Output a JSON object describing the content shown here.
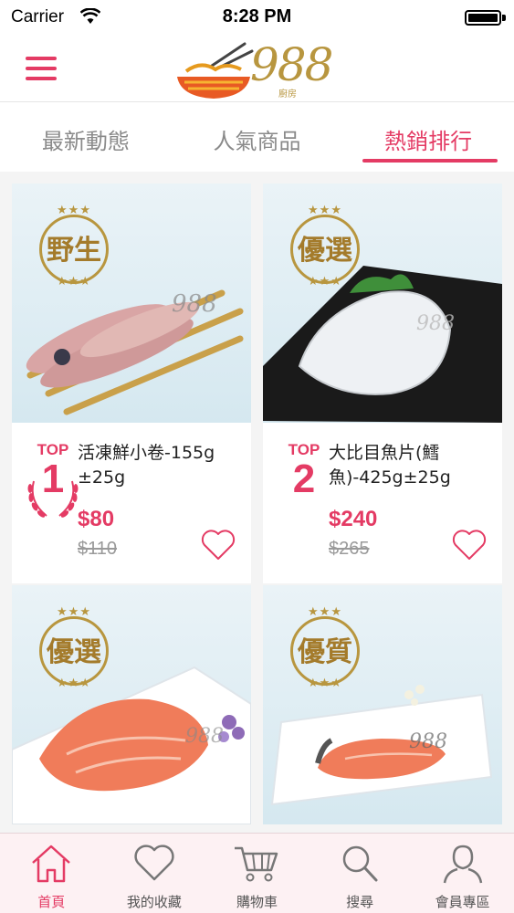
{
  "status_bar": {
    "carrier": "Carrier",
    "time": "8:28 PM"
  },
  "header": {
    "logo_text": "988",
    "logo_sub": "廚房"
  },
  "tabs": [
    {
      "label": "最新動態"
    },
    {
      "label": "人氣商品"
    },
    {
      "label": "熱銷排行"
    }
  ],
  "products": [
    {
      "badge": "野生",
      "rank_label": "TOP",
      "rank": "1",
      "name": "活凍鮮小卷-155g ±25g",
      "price": "$80",
      "old_price": "$110"
    },
    {
      "badge": "優選",
      "rank_label": "TOP",
      "rank": "2",
      "name": "大比目魚片(鱈魚)-425g±25g",
      "price": "$240",
      "old_price": "$265"
    },
    {
      "badge": "優選"
    },
    {
      "badge": "優質"
    }
  ],
  "bottom_tabs": [
    {
      "label": "首頁",
      "icon": "home-icon"
    },
    {
      "label": "我的收藏",
      "icon": "heart-icon"
    },
    {
      "label": "購物車",
      "icon": "cart-icon"
    },
    {
      "label": "搜尋",
      "icon": "search-icon"
    },
    {
      "label": "會員專區",
      "icon": "user-icon"
    }
  ],
  "colors": {
    "accent": "#e43b64",
    "gold": "#b8963f"
  }
}
